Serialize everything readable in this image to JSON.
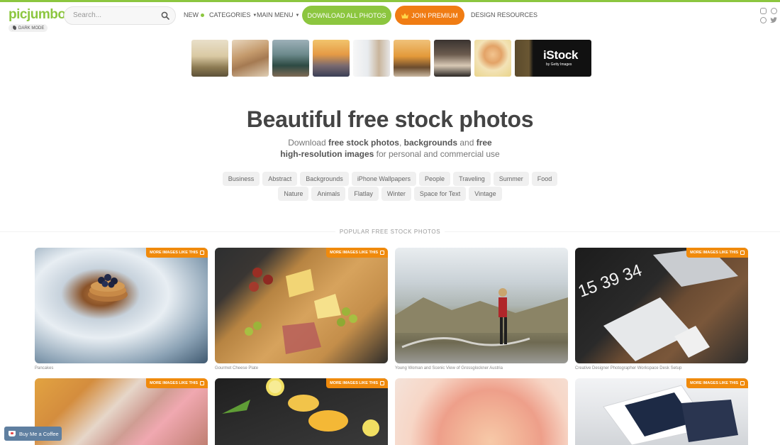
{
  "header": {
    "logo": "picjumbo",
    "dark_mode_label": "DARK MODE",
    "search_placeholder": "Search...",
    "nav": {
      "new": "NEW",
      "categories": "CATEGORIES",
      "main_menu": "MAIN MENU",
      "download_all": "DOWNLOAD ALL PHOTOS",
      "join_premium": "JOIN PREMIUM",
      "design_resources": "DESIGN RESOURCES"
    },
    "social_icons": [
      "instagram-icon",
      "facebook-icon",
      "pinterest-icon",
      "twitter-icon"
    ]
  },
  "ad_strip": {
    "istock_title": "iStock",
    "istock_subtitle": "by Getty Images"
  },
  "hero": {
    "title": "Beautiful free stock photos",
    "subtitle": {
      "t1": "Download ",
      "b1": "free stock photos",
      "t2": ", ",
      "b2": "backgrounds",
      "t3": " and ",
      "b3": "free high-resolution images",
      "t4": " for personal and commercial use"
    }
  },
  "tags": {
    "row1": [
      "Business",
      "Abstract",
      "Backgrounds",
      "iPhone Wallpapers",
      "People",
      "Traveling",
      "Summer",
      "Food"
    ],
    "row2": [
      "Nature",
      "Animals",
      "Flatlay",
      "Winter",
      "Space for Text",
      "Vintage"
    ]
  },
  "popular": {
    "heading": "POPULAR FREE STOCK PHOTOS",
    "badge_label": "MORE IMAGES LIKE THIS",
    "photos": [
      {
        "caption": "Pancakes"
      },
      {
        "caption": "Gourmet Cheese Plate"
      },
      {
        "caption": "Young Woman and Scenic View of Grossglockner Austria"
      },
      {
        "caption": "Creative Designer Photographer Workspace Desk Setup"
      }
    ]
  },
  "coffee_button": "Buy Me a Coffee",
  "colors": {
    "brand_green": "#8cc63f",
    "premium_orange": "#f07c13",
    "badge_orange": "#f08a0c"
  }
}
